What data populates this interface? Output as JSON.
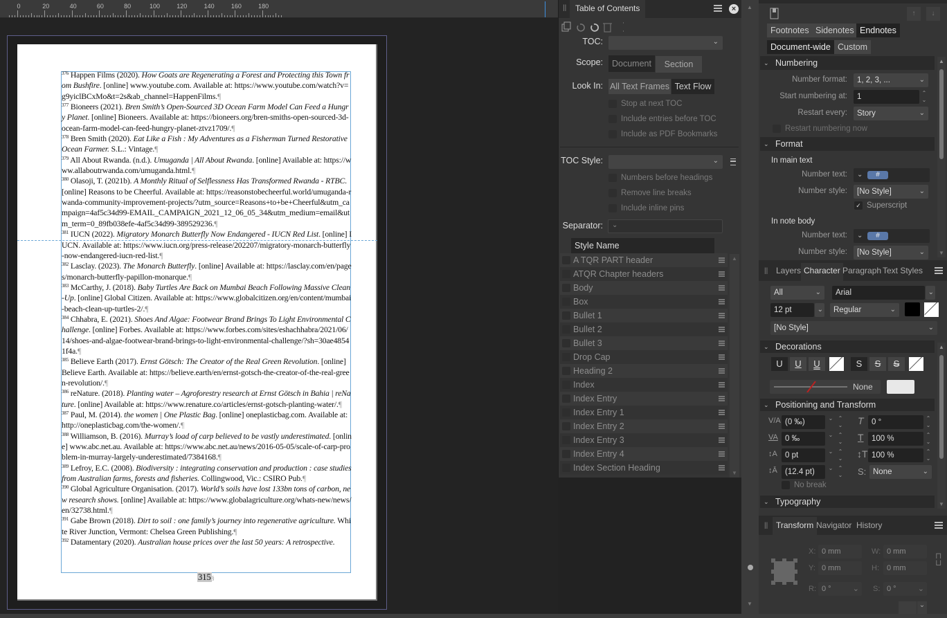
{
  "ruler": {
    "labels": [
      "0",
      "20",
      "40",
      "60",
      "80",
      "100",
      "120",
      "140",
      "160",
      "180"
    ]
  },
  "document": {
    "entries": [
      {
        "num": "376",
        "parts": [
          [
            "n",
            "Happen Films (2020). "
          ],
          [
            "i",
            "How Goats are Regenerating a Forest and Protecting this Town from Bushfire"
          ],
          [
            "n",
            ". [online] www.youtube.com. Available at: https://www.youtube.com/watch?v=g9yiclBCxMo&t=2s&ab_channel=HappenFilms."
          ]
        ]
      },
      {
        "num": "377",
        "parts": [
          [
            "n",
            "Bioneers (2021). "
          ],
          [
            "i",
            "Bren Smith’s Open-Sourced 3D Ocean Farm Model Can Feed a Hungry Planet"
          ],
          [
            "n",
            ". [online] Bioneers. Available at: https://bioneers.org/bren-smiths-open-sourced-3d-ocean-farm-model-can-feed-hungry-planet-ztvz1709/."
          ]
        ]
      },
      {
        "num": "378",
        "parts": [
          [
            "n",
            "Bren Smith (2020). "
          ],
          [
            "i",
            "Eat Like a Fish : My Adventures as a Fisherman Turned Restorative Ocean Farmer."
          ],
          [
            "n",
            " S.L.: Vintage."
          ]
        ]
      },
      {
        "num": "379",
        "parts": [
          [
            "n",
            "All About Rwanda. (n.d.). "
          ],
          [
            "i",
            "Umuganda | All About Rwanda"
          ],
          [
            "n",
            ". [online] Available at: https://www.allaboutrwanda.com/umuganda.html."
          ]
        ]
      },
      {
        "num": "380",
        "parts": [
          [
            "n",
            "Olasoji, T. (2021b). "
          ],
          [
            "i",
            "A Monthly Ritual of Selflessness Has Transformed Rwanda - RTBC"
          ],
          [
            "n",
            ". [online] Reasons to be Cheerful. Available at: https://reasonstobecheerful.world/umuganda-rwanda-community-improvement-projects/?utm_source=Reasons+to+be+Cheerful&utm_campaign=4af5c34d99-EMAIL_CAMPAIGN_2021_12_06_05_34&utm_medium=email&utm_term=0_89fb038efe-4af5c34d99-389529236."
          ]
        ]
      },
      {
        "num": "381",
        "parts": [
          [
            "n",
            "IUCN (2022). "
          ],
          [
            "i",
            "Migratory Monarch Butterfly Now Endangered - IUCN Red List"
          ],
          [
            "n",
            ". [online] IUCN. Available at: https://www.iucn.org/press-release/202207/migratory-monarch-butterfly-now-endangered-iucn-red-list."
          ]
        ]
      },
      {
        "num": "382",
        "parts": [
          [
            "n",
            "Lasclay. (2023). "
          ],
          [
            "i",
            "The Monarch Butterfly"
          ],
          [
            "n",
            ". [online] Available at: https://lasclay.com/en/pages/monarch-butterfly-papillon-monarque."
          ]
        ]
      },
      {
        "num": "383",
        "parts": [
          [
            "n",
            "McCarthy, J. (2018). "
          ],
          [
            "i",
            "Baby Turtles Are Back on Mumbai Beach Following Massive Clean-Up"
          ],
          [
            "n",
            ". [online] Global Citizen. Available at: https://www.globalcitizen.org/en/content/mumbai-beach-clean-up-turtles-2/."
          ]
        ]
      },
      {
        "num": "384",
        "parts": [
          [
            "n",
            "Chhabra, E. (2021). "
          ],
          [
            "i",
            "Shoes And Algae: Footwear Brand Brings To Light Environmental Challenge"
          ],
          [
            "n",
            ". [online] Forbes. Available at: https://www.forbes.com/sites/eshachhabra/2021/06/14/shoes-and-algae-footwear-brand-brings-to-light-environmental-challenge/?sh=30ae48541f4a."
          ]
        ]
      },
      {
        "num": "385",
        "parts": [
          [
            "n",
            "Believe Earth (2017). "
          ],
          [
            "i",
            "Ernst Götsch: The Creator of the Real Green Revolution"
          ],
          [
            "n",
            ". [online] Believe Earth. Available at: https://believe.earth/en/ernst-gotsch-the-creator-of-the-real-green-revolution/."
          ]
        ]
      },
      {
        "num": "386",
        "parts": [
          [
            "n",
            "reNature. (2018). "
          ],
          [
            "i",
            "Planting water – Agroforestry research at Ernst Götsch in Bahia | reNature"
          ],
          [
            "n",
            ". [online] Available at: https://www.renature.co/articles/ernst-gotsch-planting-water/."
          ]
        ]
      },
      {
        "num": "387",
        "parts": [
          [
            "n",
            "Paul, M. (2014). "
          ],
          [
            "i",
            "the women | One Plastic Bag"
          ],
          [
            "n",
            ". [online] oneplasticbag.com. Available at: http://oneplasticbag.com/the-women/."
          ]
        ]
      },
      {
        "num": "388",
        "parts": [
          [
            "n",
            "Williamson, B. (2016). "
          ],
          [
            "i",
            "Murray’s load of carp believed to be vastly underestimated"
          ],
          [
            "n",
            ". [online] www.abc.net.au. Available at: https://www.abc.net.au/news/2016-05-05/scale-of-carp-problem-in-murray-largely-underestimated/7384168."
          ]
        ]
      },
      {
        "num": "389",
        "parts": [
          [
            "n",
            "Lefroy, E.C. (2008). "
          ],
          [
            "i",
            "Biodiversity : integrating conservation and production : case studies from Australian farms, forests and fisheries."
          ],
          [
            "n",
            " Collingwood, Vic.: CSIRO Pub."
          ]
        ]
      },
      {
        "num": "390",
        "parts": [
          [
            "n",
            "Global Agriculture Organisation. (2017). "
          ],
          [
            "i",
            "World’s soils have lost 133bn tons of carbon, new research shows."
          ],
          [
            "n",
            " [online] Available at: https://www.globalagriculture.org/whats-new/news/en/32738.html."
          ]
        ]
      },
      {
        "num": "391",
        "parts": [
          [
            "n",
            "Gabe Brown (2018). "
          ],
          [
            "i",
            "Dirt to soil : one family’s journey into regenerative agriculture."
          ],
          [
            "n",
            " White River Junction, Vermont: Chelsea Green Publishing."
          ]
        ]
      },
      {
        "num": "392",
        "parts": [
          [
            "n",
            "Datamentary (2020). "
          ],
          [
            "i",
            "Australian house prices over the last 50 years: A retrospective."
          ],
          [
            "n",
            ""
          ]
        ]
      }
    ],
    "pilcrow": "¶",
    "page_number": "315",
    "section_mark": "§"
  },
  "toc_panel": {
    "title": "Table of Contents",
    "toc_label": "TOC:",
    "toc_value": "",
    "scope_label": "Scope:",
    "scope_options": [
      "Document",
      "Section"
    ],
    "lookin_label": "Look In:",
    "lookin_options": [
      "All Text Frames",
      "Text Flow"
    ],
    "options": [
      "Stop at next TOC",
      "Include entries before TOC",
      "Include as PDF Bookmarks"
    ],
    "toc_style_label": "TOC Style:",
    "toc_style_value": "",
    "style_options": [
      "Numbers before headings",
      "Remove line breaks",
      "Include inline pins"
    ],
    "separator_label": "Separator:",
    "separator_value": "",
    "style_header": "Style Name",
    "styles": [
      "A TQR PART header",
      "ATQR Chapter headers",
      "Body",
      "Box",
      "Bullet 1",
      "Bullet 2",
      "Bullet 3",
      "Drop Cap",
      "Heading 2",
      "Index",
      "Index Entry",
      "Index Entry 1",
      "Index Entry 2",
      "Index Entry 3",
      "Index Entry 4",
      "Index Section Heading"
    ]
  },
  "notes_panel": {
    "type_tabs": [
      "Footnotes",
      "Sidenotes",
      "Endnotes"
    ],
    "selected_type": "Endnotes",
    "scope_tabs": [
      "Document-wide",
      "Custom"
    ],
    "selected_scope": "Document-wide",
    "numbering": {
      "title": "Numbering",
      "number_format_label": "Number format:",
      "number_format": "1, 2, 3, ...",
      "start_label": "Start numbering at:",
      "start_value": "1",
      "restart_label": "Restart every:",
      "restart_value": "Story",
      "restart_now": "Restart numbering now"
    },
    "format": {
      "title": "Format",
      "main_text": "In main text",
      "number_text_label": "Number text:",
      "token": "#",
      "number_style_label": "Number style:",
      "number_style": "[No Style]",
      "superscript": "Superscript",
      "superscript_checked": true,
      "note_body": "In note body",
      "body_number_style": "[No Style]"
    }
  },
  "character_panel": {
    "tabs": [
      "Layers",
      "Character",
      "Paragraph",
      "Text Styles"
    ],
    "selected_tab": "Character",
    "scope": "All",
    "font": "Arial",
    "size": "12 pt",
    "weight": "Regular",
    "text_color": "#000000",
    "char_style": "[No Style]",
    "decorations_title": "Decorations",
    "deco_buttons": [
      "U",
      "U",
      "U",
      "S",
      "S",
      "S"
    ],
    "line_style": "None",
    "positioning_title": "Positioning and Transform",
    "tracking": "(0 ‰)",
    "kerning": "0 ‰",
    "baseline": "0 pt",
    "leading": "(12.4 pt)",
    "shear": "0 °",
    "hscale": "100 %",
    "vscale": "100 %",
    "typo_pos": "None",
    "no_break": "No break",
    "typography_title": "Typography"
  },
  "transform_panel": {
    "tabs": [
      "Transform",
      "Navigator",
      "History"
    ],
    "selected_tab": "Transform",
    "x_label": "X:",
    "x": "0 mm",
    "y_label": "Y:",
    "y": "0 mm",
    "w_label": "W:",
    "w": "0 mm",
    "h_label": "H:",
    "h": "0 mm",
    "r_label": "R:",
    "r": "0 °",
    "s_label": "S:",
    "s": "0 °"
  }
}
